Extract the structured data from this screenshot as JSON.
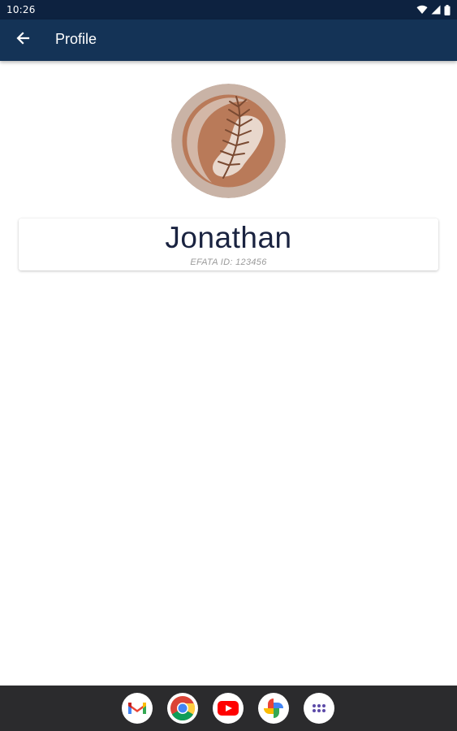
{
  "status_bar": {
    "time": "10:26",
    "icons": [
      "wifi-icon",
      "signal-icon",
      "battery-icon"
    ]
  },
  "app_bar": {
    "back_icon": "arrow-left-icon",
    "title": "Profile",
    "background": "#143356"
  },
  "profile": {
    "avatar": "leaf-avatar",
    "name": "Jonathan",
    "id_text": "EFATA ID: 123456"
  },
  "dock": {
    "apps": [
      {
        "name": "Gmail",
        "icon": "gmail-icon"
      },
      {
        "name": "Chrome",
        "icon": "chrome-icon"
      },
      {
        "name": "YouTube",
        "icon": "youtube-icon"
      },
      {
        "name": "Photos",
        "icon": "photos-icon"
      },
      {
        "name": "All apps",
        "icon": "app-drawer-icon"
      }
    ]
  },
  "colors": {
    "status_bar": "#0d2240",
    "app_bar": "#143356",
    "name_text": "#1a2340",
    "nav_bar": "#2b2b2d"
  }
}
